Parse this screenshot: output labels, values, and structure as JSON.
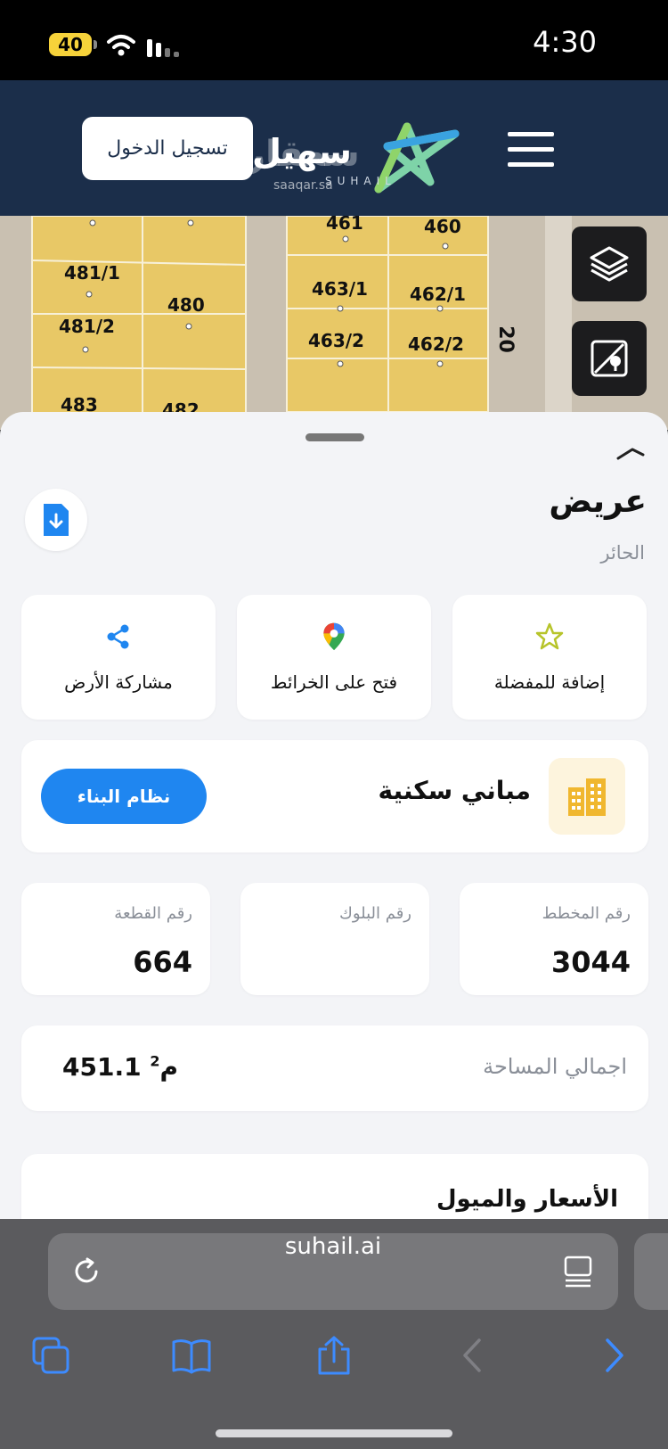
{
  "status_bar": {
    "time": "4:30",
    "battery": "40"
  },
  "header": {
    "login_label": "تسجيل الدخول",
    "brand_name": "سهيل",
    "watermark": "سعقار",
    "watermark_url": "saaqar.sa",
    "brand_sub": "SUHAIL"
  },
  "map": {
    "plots": [
      "481/1",
      "480",
      "481/2",
      "483",
      "482",
      "461",
      "460",
      "463/1",
      "462/1",
      "463/2",
      "462/2"
    ],
    "street_width": "20"
  },
  "sheet": {
    "title": "عريض",
    "subtitle": "الحائر",
    "actions": [
      {
        "label": "إضافة للمفضلة",
        "icon": "star-icon"
      },
      {
        "label": "فتح على الخرائط",
        "icon": "map-pin-icon"
      },
      {
        "label": "مشاركة الأرض",
        "icon": "share-icon"
      }
    ],
    "usage": {
      "label": "مباني سكنية",
      "button": "نظام البناء"
    },
    "stats": [
      {
        "key": "رقم المخطط",
        "value": "3044"
      },
      {
        "key": "رقم البلوك",
        "value": ""
      },
      {
        "key": "رقم القطعة",
        "value": "664"
      }
    ],
    "area": {
      "key": "اجمالي المساحة",
      "value": "451.1",
      "unit": "م",
      "unit_sup": "2"
    },
    "prices_title": "الأسعار والميول"
  },
  "browser": {
    "url": "suhail.ai"
  },
  "colors": {
    "header_bg": "#1b2e4a",
    "accent_blue": "#1f86f0",
    "plot_yellow": "#e8c866",
    "sheet_bg": "#f3f4f7"
  }
}
